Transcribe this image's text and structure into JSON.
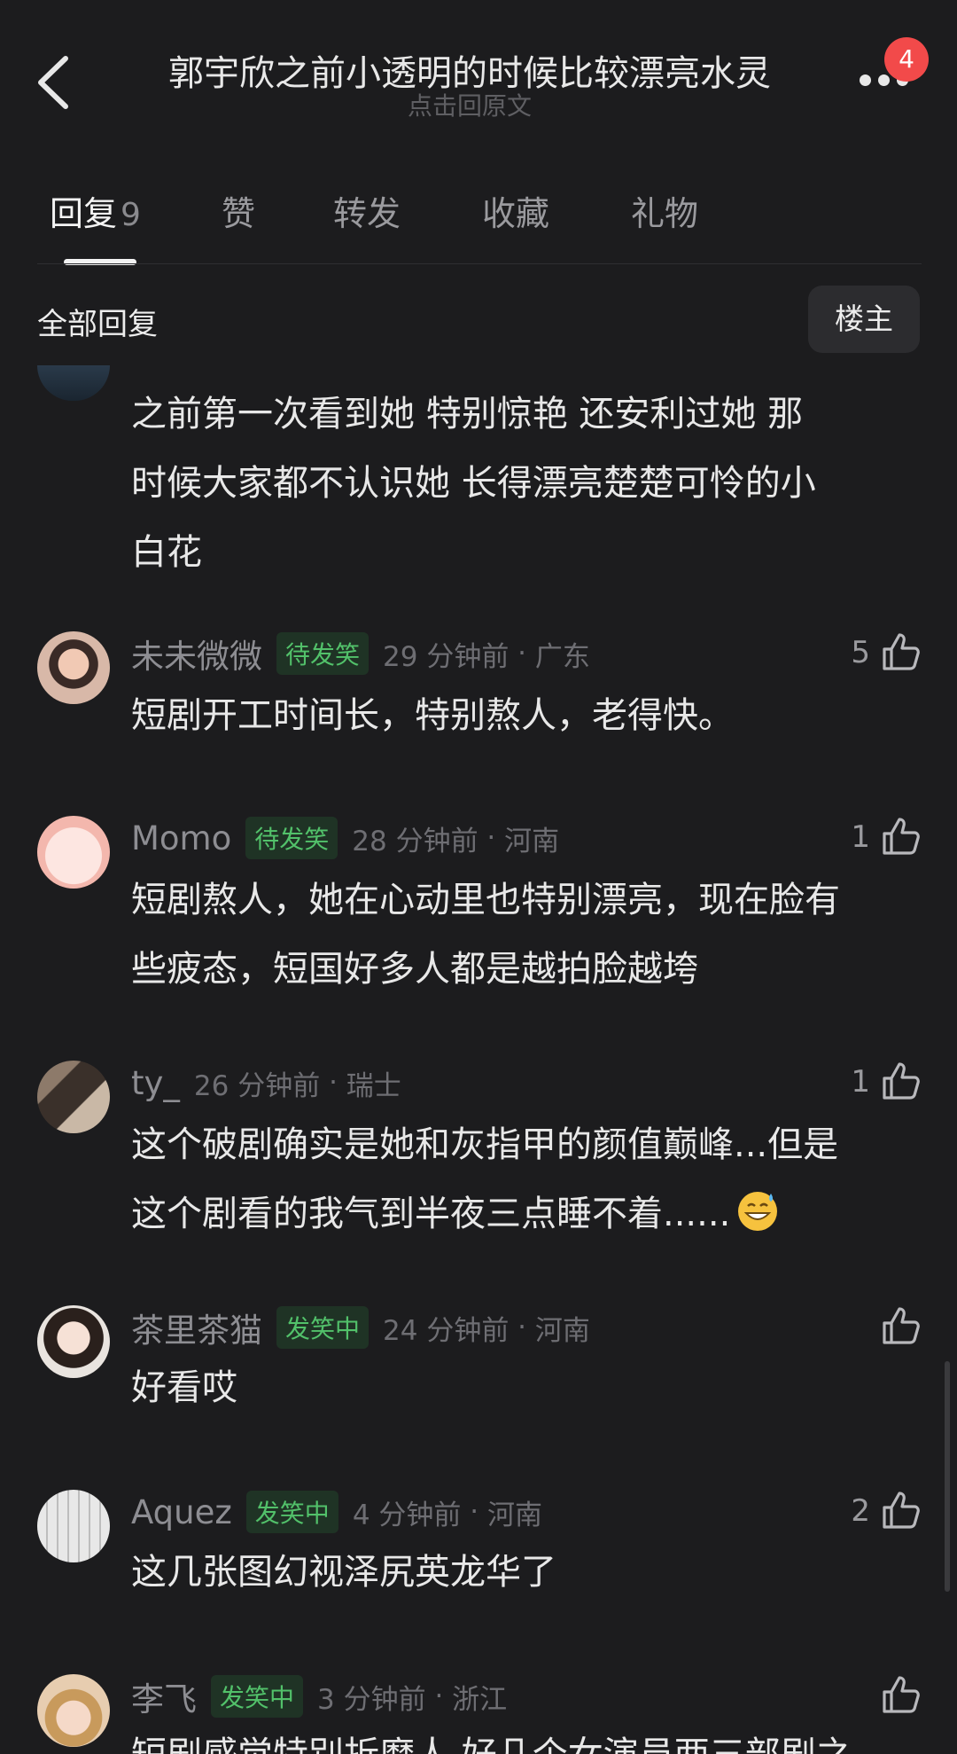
{
  "header": {
    "title": "郭宇欣之前小透明的时候比较漂亮水灵",
    "subtitle": "点击回原文",
    "notification_count": "4"
  },
  "tabs": [
    {
      "label": "回复",
      "count": "9"
    },
    {
      "label": "赞"
    },
    {
      "label": "转发"
    },
    {
      "label": "收藏"
    },
    {
      "label": "礼物"
    }
  ],
  "section": {
    "title": "全部回复",
    "filter_label": "楼主"
  },
  "colors": {
    "background": "#1c1c1e",
    "badge_green": "#52c16a",
    "notification_red": "#f24a4a"
  },
  "partial_comment": {
    "text_lines": [
      "之前第一次看到她 特别惊艳   还安利过她  那",
      "时候大家都不认识她   长得漂亮楚楚可怜的小",
      "白花"
    ]
  },
  "comments": [
    {
      "username": "未未微微",
      "badge": "待发笑",
      "time": "29 分钟前",
      "location": "广东",
      "likes": "5",
      "text_lines": [
        "短剧开工时间长，特别熬人，老得快。"
      ]
    },
    {
      "username": "Momo",
      "badge": "待发笑",
      "time": "28 分钟前",
      "location": "河南",
      "likes": "1",
      "text_lines": [
        "短剧熬人，她在心动里也特别漂亮，现在脸有",
        "些疲态，短国好多人都是越拍脸越垮"
      ]
    },
    {
      "username": "ty_",
      "badge": "",
      "time": "26 分钟前",
      "location": "瑞士",
      "likes": "1",
      "text_lines": [
        "这个破剧确实是她和灰指甲的颜值巅峰...但是",
        "这个剧看的我气到半夜三点睡不着......"
      ],
      "emoji": "sweat-smile-emoji"
    },
    {
      "username": "茶里茶猫",
      "badge": "发笑中",
      "time": "24 分钟前",
      "location": "河南",
      "likes": "",
      "text_lines": [
        "好看哎"
      ]
    },
    {
      "username": "Aquez",
      "badge": "发笑中",
      "time": "4 分钟前",
      "location": "河南",
      "likes": "2",
      "text_lines": [
        "这几张图幻视泽尻英龙华了"
      ]
    },
    {
      "username": "李飞",
      "badge": "发笑中",
      "time": "3 分钟前",
      "location": "浙江",
      "likes": "",
      "text_lines": [
        "短剧感觉特别折磨人 好几个女演员两三部剧之"
      ]
    }
  ]
}
